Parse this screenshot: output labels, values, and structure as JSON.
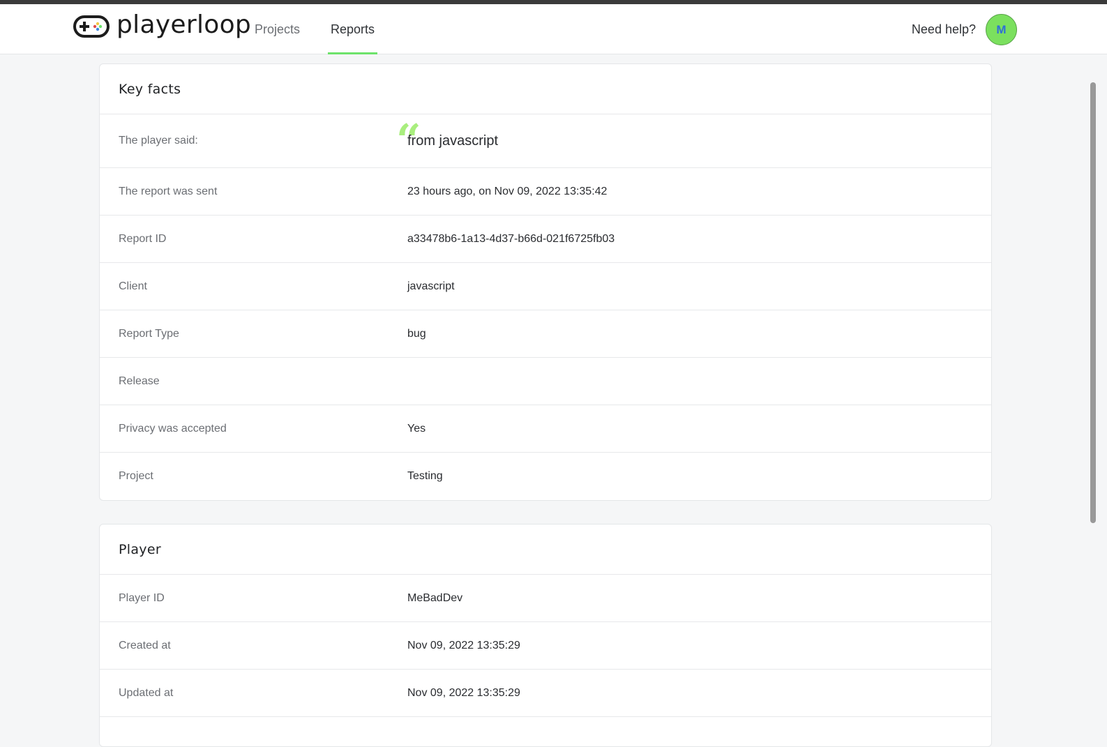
{
  "nav": {
    "brand": "playerloop",
    "links": [
      "Projects",
      "Reports"
    ],
    "active_link": "Reports",
    "help_label": "Need help?",
    "avatar_initial": "M",
    "accent_color": "#6de36b"
  },
  "key_facts": {
    "title": "Key facts",
    "player_said_label": "The player said:",
    "player_said_value": "from javascript",
    "rows": [
      {
        "label": "The report was sent",
        "value": "23 hours ago, on Nov 09, 2022 13:35:42"
      },
      {
        "label": "Report ID",
        "value": "a33478b6-1a13-4d37-b66d-021f6725fb03"
      },
      {
        "label": "Client",
        "value": "javascript"
      },
      {
        "label": "Report Type",
        "value": "bug"
      },
      {
        "label": "Release",
        "value": ""
      },
      {
        "label": "Privacy was accepted",
        "value": "Yes"
      },
      {
        "label": "Project",
        "value": "Testing"
      }
    ]
  },
  "player": {
    "title": "Player",
    "rows": [
      {
        "label": "Player ID",
        "value": "MeBadDev"
      },
      {
        "label": "Created at",
        "value": "Nov 09, 2022 13:35:29"
      },
      {
        "label": "Updated at",
        "value": "Nov 09, 2022 13:35:29"
      }
    ]
  }
}
